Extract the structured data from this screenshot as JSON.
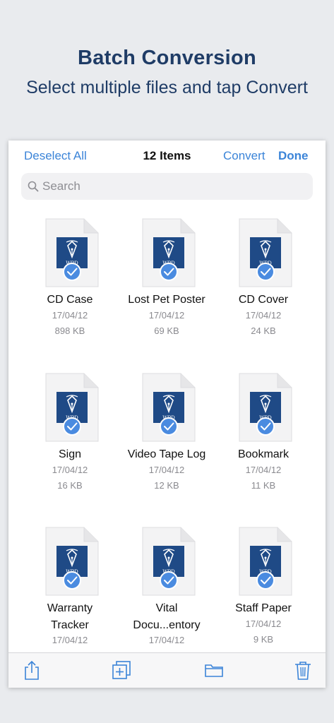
{
  "promo": {
    "title": "Batch Conversion",
    "subtitle": "Select multiple files and tap Convert"
  },
  "topbar": {
    "left_label": "Deselect All",
    "title": "12 Items",
    "convert_label": "Convert",
    "done_label": "Done"
  },
  "search": {
    "placeholder": "Search",
    "value": ""
  },
  "files": [
    {
      "name": "CD Case",
      "date": "17/04/12",
      "size": "898 KB",
      "selected": true,
      "icon": "wpd-file-icon"
    },
    {
      "name": "Lost Pet Poster",
      "date": "17/04/12",
      "size": "69 KB",
      "selected": true,
      "icon": "wpd-file-icon"
    },
    {
      "name": "CD Cover",
      "date": "17/04/12",
      "size": "24 KB",
      "selected": true,
      "icon": "wpd-file-icon"
    },
    {
      "name": "Sign",
      "date": "17/04/12",
      "size": "16 KB",
      "selected": true,
      "icon": "wpd-file-icon"
    },
    {
      "name": "Video Tape Log",
      "date": "17/04/12",
      "size": "12 KB",
      "selected": true,
      "icon": "wpd-file-icon"
    },
    {
      "name": "Bookmark",
      "date": "17/04/12",
      "size": "11 KB",
      "selected": true,
      "icon": "wpd-file-icon"
    },
    {
      "name_line1": "Warranty",
      "name_line2": "Tracker",
      "date": "17/04/12",
      "selected": true,
      "icon": "wpd-file-icon"
    },
    {
      "name_line1": "Vital",
      "name_line2": "Docu...entory",
      "date": "17/04/12",
      "selected": true,
      "icon": "wpd-file-icon"
    },
    {
      "name": "Staff Paper",
      "date": "17/04/12",
      "size": "9 KB",
      "selected": true,
      "icon": "wpd-file-icon"
    }
  ],
  "file_badge_text": "WPD",
  "toolbar": [
    "share-icon",
    "duplicate-icon",
    "folder-icon",
    "trash-icon"
  ],
  "colors": {
    "accent": "#3b84d8",
    "heading": "#1f3c66",
    "badge": "#1f4a86",
    "check": "#4a8be0"
  }
}
